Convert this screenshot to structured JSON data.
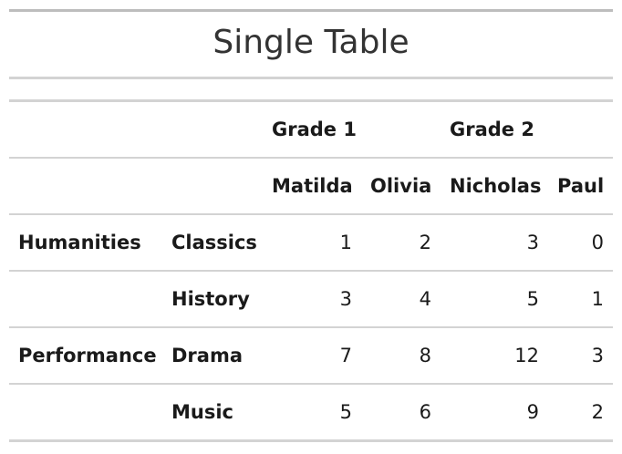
{
  "title": "Single Table",
  "header": {
    "grades": [
      "Grade 1",
      "Grade 2"
    ],
    "students": [
      "Matilda",
      "Olivia",
      "Nicholas",
      "Paul"
    ]
  },
  "rows": [
    {
      "group": "Humanities",
      "subject": "Classics",
      "values": [
        "1",
        "2",
        "3",
        "0"
      ]
    },
    {
      "group": "",
      "subject": "History",
      "values": [
        "3",
        "4",
        "5",
        "1"
      ]
    },
    {
      "group": "Performance",
      "subject": "Drama",
      "values": [
        "7",
        "8",
        "12",
        "3"
      ]
    },
    {
      "group": "",
      "subject": "Music",
      "values": [
        "5",
        "6",
        "9",
        "2"
      ]
    }
  ]
}
